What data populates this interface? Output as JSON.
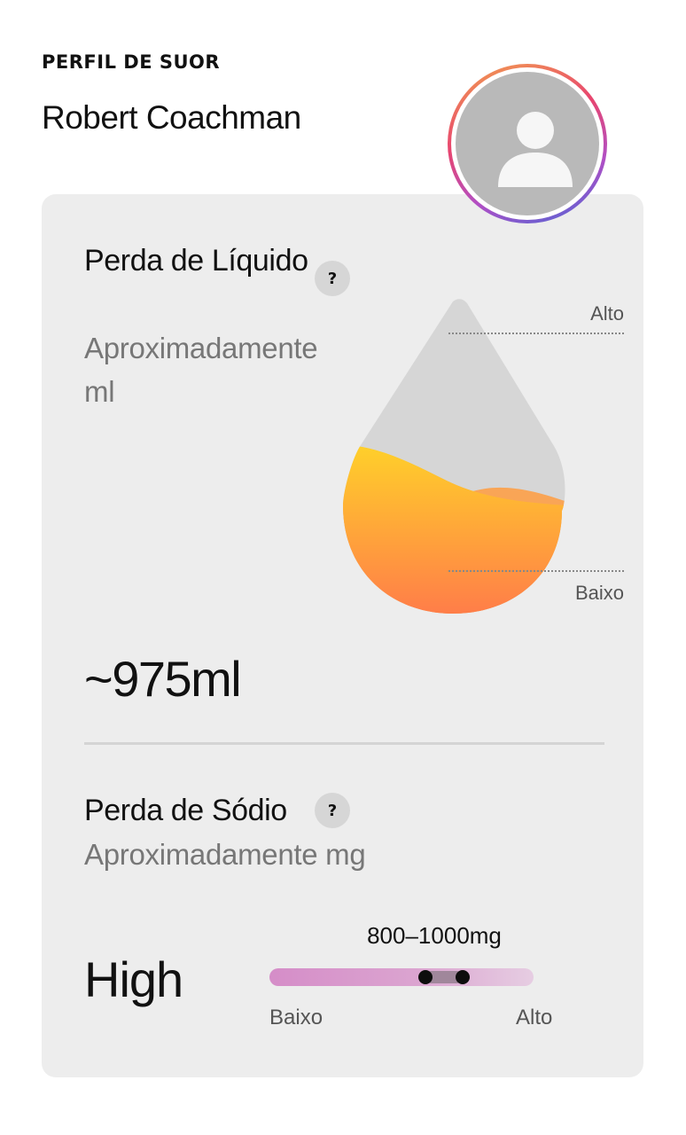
{
  "header": {
    "kicker": "PERFIL DE SUOR",
    "user_name": "Robert Coachman",
    "avatar_icon": "person-icon"
  },
  "fluid": {
    "title": "Perda de Líquido",
    "subtitle": "Aproximadamente ml",
    "help_label": "?",
    "level_high": "Alto",
    "level_low": "Baixo",
    "fill_fraction": 0.47,
    "value": "~975ml",
    "colors": {
      "fill_top": "#ffd02a",
      "fill_bottom": "#ff7a4a",
      "drop_empty": "#d6d6d6"
    }
  },
  "sodium": {
    "title": "Perda de Sódio",
    "subtitle": "Aproximadamente mg",
    "help_label": "?",
    "level": "High",
    "range_text": "800–1000mg",
    "range_low_fraction": 0.59,
    "range_high_fraction": 0.73,
    "scale_low": "Baixo",
    "scale_high": "Alto",
    "colors": {
      "track_start": "#d58dc8",
      "track_end": "#e6cde2"
    }
  }
}
